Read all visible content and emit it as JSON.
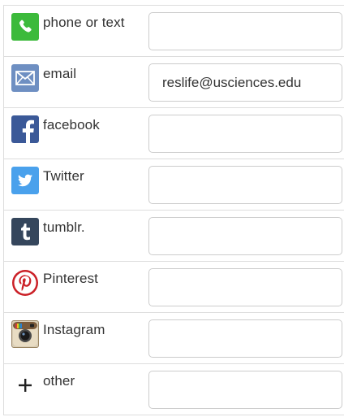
{
  "rows": [
    {
      "label": "phone or text",
      "icon": "phone-icon",
      "value": "",
      "color": "#3cba3b"
    },
    {
      "label": "email",
      "icon": "envelope-icon",
      "value": "reslife@usciences.edu",
      "color": "#6e8fc2"
    },
    {
      "label": "facebook",
      "icon": "facebook-icon",
      "value": "",
      "color": "#3b5998"
    },
    {
      "label": "Twitter",
      "icon": "twitter-bird-icon",
      "value": "",
      "color": "#4aa1ec"
    },
    {
      "label": "tumblr.",
      "icon": "tumblr-icon",
      "value": "",
      "color": "#35465c"
    },
    {
      "label": "Pinterest",
      "icon": "pinterest-icon",
      "value": "",
      "color": "#cb2027"
    },
    {
      "label": "Instagram",
      "icon": "instagram-camera-icon",
      "value": "",
      "color": "#d9cdb5"
    },
    {
      "label": "other",
      "icon": "plus-icon",
      "value": "",
      "color": "#222222"
    }
  ]
}
